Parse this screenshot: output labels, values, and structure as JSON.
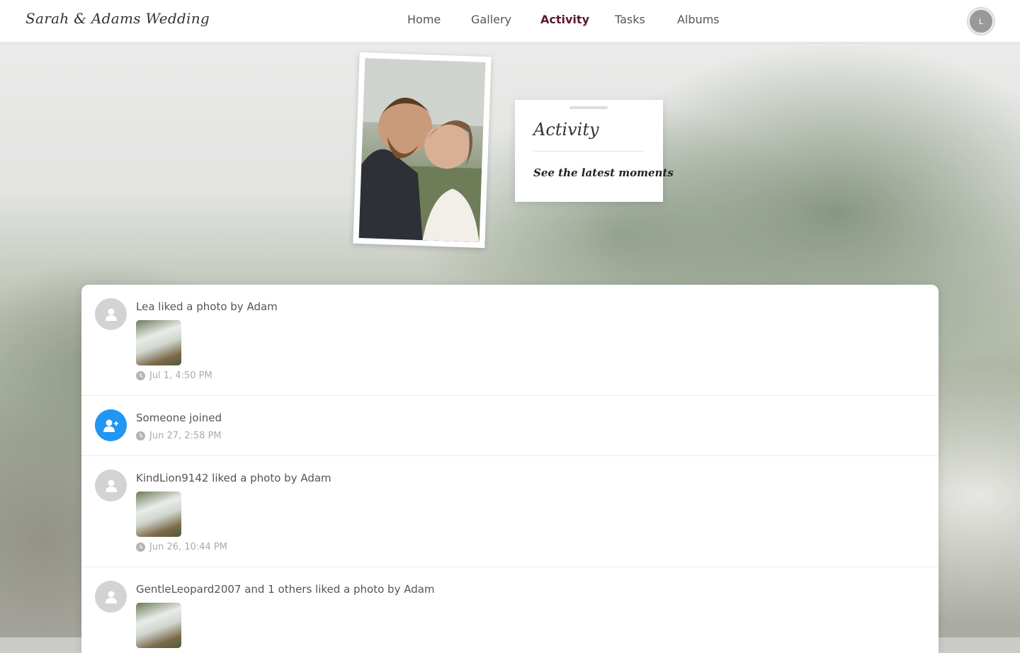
{
  "brand": {
    "title": "Sarah & Adams Wedding"
  },
  "nav": {
    "items": [
      {
        "label": "Home",
        "active": false
      },
      {
        "label": "Gallery",
        "active": false
      },
      {
        "label": "Activity",
        "active": true
      },
      {
        "label": "Tasks",
        "active": false
      },
      {
        "label": "Albums",
        "active": false
      }
    ]
  },
  "profile": {
    "initial": "L"
  },
  "hero": {
    "title": "Activity",
    "subtitle": "See the latest moments"
  },
  "feed": {
    "items": [
      {
        "text": "Lea liked a photo by Adam",
        "time": "Jul 1, 4:50 PM",
        "avatar": "user-icon",
        "has_thumb": true
      },
      {
        "text": "Someone joined",
        "time": "Jun 27, 2:58 PM",
        "avatar": "user-plus-icon",
        "has_thumb": false
      },
      {
        "text": "KindLion9142 liked a photo by Adam",
        "time": "Jun 26, 10:44 PM",
        "avatar": "user-icon",
        "has_thumb": true
      },
      {
        "text": "GentleLeopard2007 and 1 others liked a photo by Adam",
        "time": "",
        "avatar": "user-icon",
        "has_thumb": true
      }
    ]
  },
  "colors": {
    "accent": "#5a1a2c",
    "join_blue": "#2196f3"
  }
}
